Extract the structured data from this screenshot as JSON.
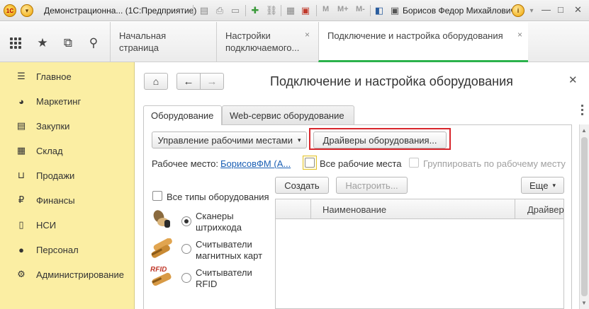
{
  "titlebar": {
    "logo_text": "1С",
    "title": "Демонстрационна... (1С:Предприятие)",
    "m_labels": [
      "M",
      "M+",
      "M-"
    ],
    "user": "Борисов Федор Михайлович",
    "info": "i",
    "minimize": "—",
    "maximize": "□",
    "close": "✕"
  },
  "top_tabs": [
    {
      "label": "Начальная страница"
    },
    {
      "label": "Настройки подключаемого...",
      "close": "×"
    },
    {
      "label": "Подключение и настройка оборудования",
      "close": "×"
    }
  ],
  "sidebar": {
    "items": [
      {
        "label": "Главное",
        "icon": "menu-icon"
      },
      {
        "label": "Маркетинг",
        "icon": "pie-chart-icon"
      },
      {
        "label": "Закупки",
        "icon": "purchases-icon"
      },
      {
        "label": "Склад",
        "icon": "warehouse-icon"
      },
      {
        "label": "Продажи",
        "icon": "basket-icon"
      },
      {
        "label": "Финансы",
        "icon": "ruble-icon"
      },
      {
        "label": "НСИ",
        "icon": "reference-icon"
      },
      {
        "label": "Персонал",
        "icon": "person-icon"
      },
      {
        "label": "Администрирование",
        "icon": "gear-icon"
      }
    ]
  },
  "form": {
    "title": "Подключение и настройка оборудования",
    "tabs": [
      "Оборудование",
      "Web-сервис оборудование"
    ],
    "manage_workplaces": "Управление рабочими местами",
    "drivers_button": "Драйверы оборудования...",
    "workplace_label": "Рабочее место:",
    "workplace_value": "БорисовФМ (А...",
    "all_workplaces": "Все рабочие места",
    "group_by_workplace": "Группировать по рабочему месту",
    "all_types": "Все типы оборудования",
    "device_types": [
      {
        "label_line1": "Сканеры",
        "label_line2": "штрихкода",
        "selected": true
      },
      {
        "label_line1": "Считыватели",
        "label_line2": "магнитных карт",
        "selected": false
      },
      {
        "label_line1": "Считыватели",
        "label_line2": "RFID",
        "selected": false
      }
    ],
    "rfid_icon_text": "RFID",
    "create_button": "Создать",
    "configure_button": "Настроить...",
    "more_button": "Еще",
    "grid_columns": [
      "Наименование",
      "Драйвер"
    ]
  },
  "colors": {
    "sidebar_bg": "#fbeea3",
    "active_tab_underline": "#2bb24c",
    "highlight_frame": "#d8262c",
    "link": "#1a5fb4"
  }
}
